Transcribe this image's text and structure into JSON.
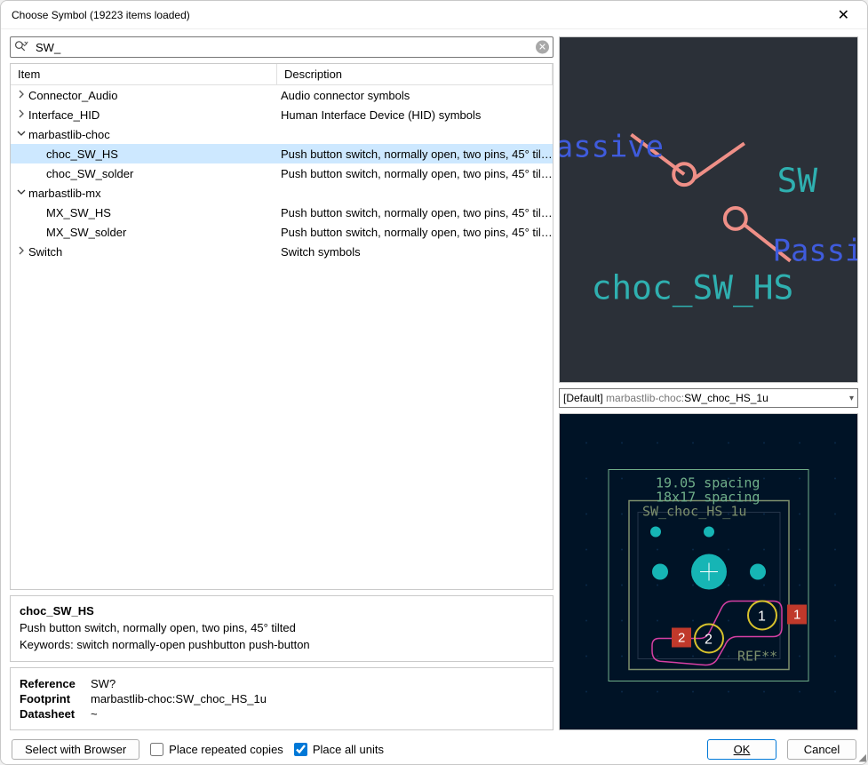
{
  "title": "Choose Symbol (19223 items loaded)",
  "search_value": "SW_",
  "columns": {
    "item": "Item",
    "description": "Description"
  },
  "rows": [
    {
      "kind": "lib",
      "expanded": false,
      "depth": 0,
      "name": "Connector_Audio",
      "desc": "Audio connector symbols"
    },
    {
      "kind": "lib",
      "expanded": false,
      "depth": 0,
      "name": "Interface_HID",
      "desc": "Human Interface Device (HID) symbols"
    },
    {
      "kind": "lib",
      "expanded": true,
      "depth": 0,
      "name": "marbastlib-choc",
      "desc": ""
    },
    {
      "kind": "sym",
      "expanded": null,
      "depth": 1,
      "name": "choc_SW_HS",
      "desc": "Push button switch, normally open, two pins, 45° tilted",
      "selected": true
    },
    {
      "kind": "sym",
      "expanded": null,
      "depth": 1,
      "name": "choc_SW_solder",
      "desc": "Push button switch, normally open, two pins, 45° tilted"
    },
    {
      "kind": "lib",
      "expanded": true,
      "depth": 0,
      "name": "marbastlib-mx",
      "desc": ""
    },
    {
      "kind": "sym",
      "expanded": null,
      "depth": 1,
      "name": "MX_SW_HS",
      "desc": "Push button switch, normally open, two pins, 45° tilted"
    },
    {
      "kind": "sym",
      "expanded": null,
      "depth": 1,
      "name": "MX_SW_solder",
      "desc": "Push button switch, normally open, two pins, 45° tilted"
    },
    {
      "kind": "lib",
      "expanded": false,
      "depth": 0,
      "name": "Switch",
      "desc": "Switch symbols"
    }
  ],
  "detail": {
    "name": "choc_SW_HS",
    "desc": "Push button switch, normally open, two pins, 45° tilted",
    "keywords_label": "Keywords:",
    "keywords": "switch normally-open pushbutton push-button",
    "fields": {
      "reference_label": "Reference",
      "reference": "SW?",
      "footprint_label": "Footprint",
      "footprint": "marbastlib-choc:SW_choc_HS_1u",
      "datasheet_label": "Datasheet",
      "datasheet": "~"
    }
  },
  "fp_selector": {
    "prefix": "[Default] ",
    "lib": "marbastlib-choc:",
    "name": "SW_choc_HS_1u"
  },
  "bottom": {
    "select_browser": "Select with Browser",
    "place_repeated": "Place repeated copies",
    "place_all": "Place all units",
    "ok": "OK",
    "cancel": "Cancel"
  },
  "symbol_preview": {
    "passive1": "assive",
    "passive2": "Passiv",
    "ref": "SW",
    "value": "choc_SW_HS"
  },
  "fp_preview": {
    "spacing1": "19.05 spacing",
    "spacing2": "18x17 spacing",
    "ref": "SW_choc_HS_1u",
    "reftag": "REF**",
    "pad1": "1",
    "pad2": "2",
    "padlabel1": "1",
    "padlabel2": "2"
  }
}
